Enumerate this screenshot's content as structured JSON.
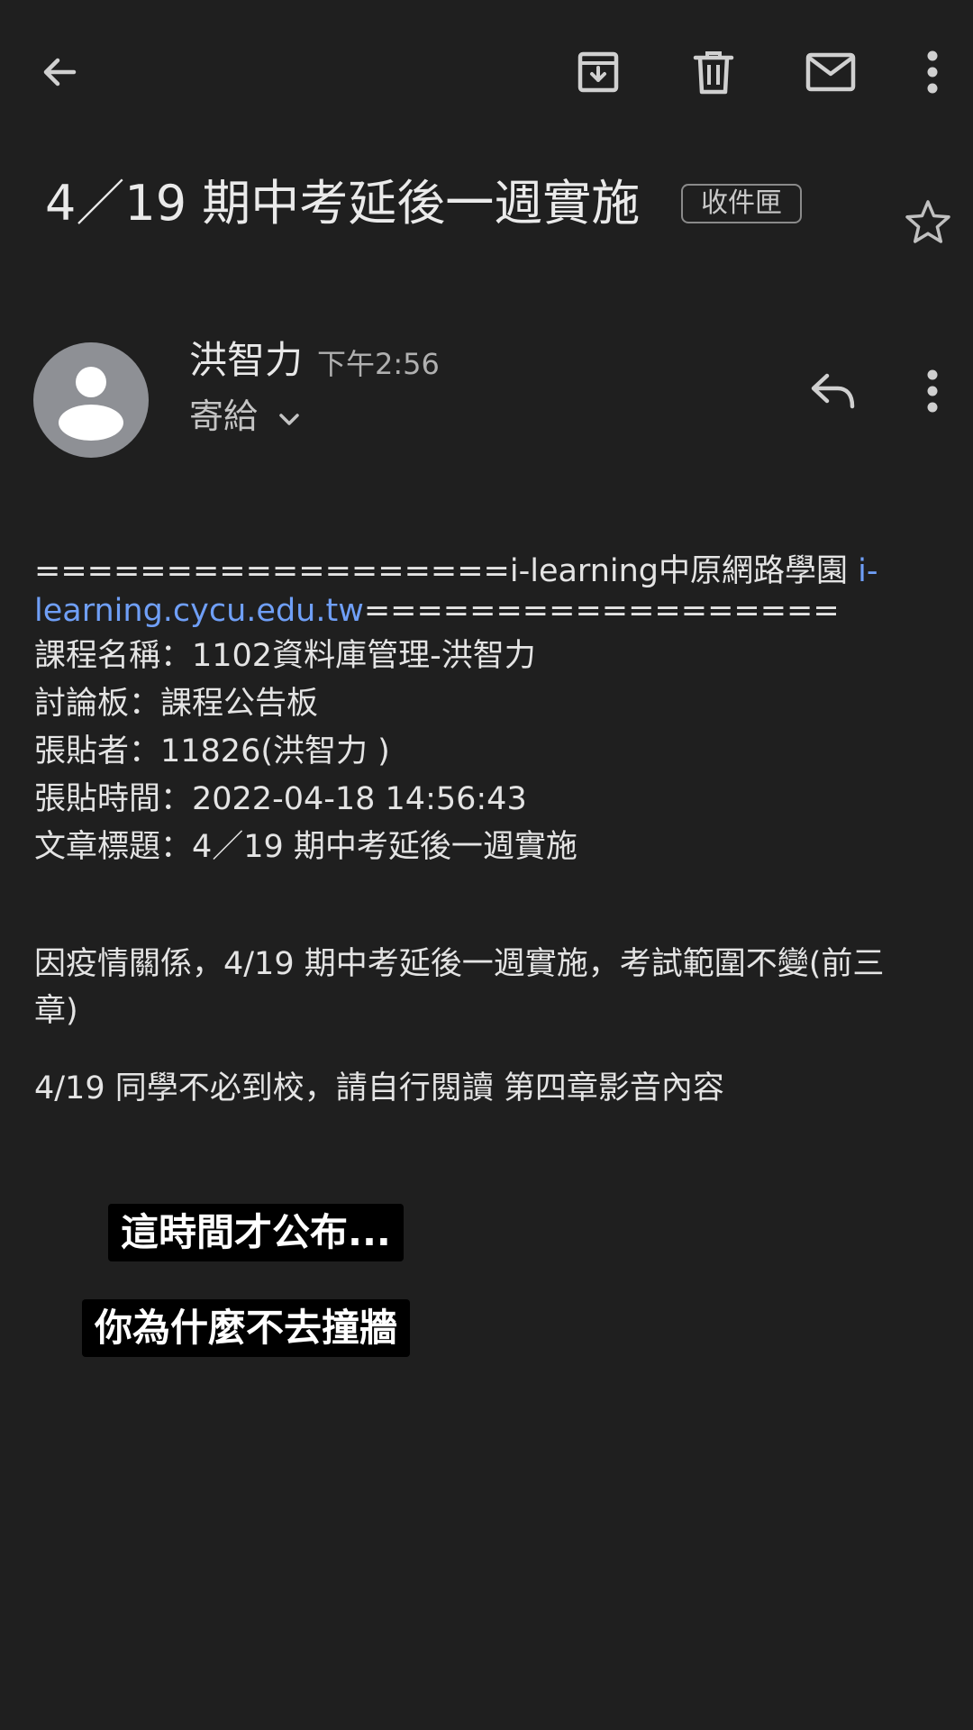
{
  "toolbar": {
    "back_icon": "arrow-back-icon",
    "archive_icon": "archive-icon",
    "delete_icon": "trash-icon",
    "mark_unread_icon": "mail-icon",
    "more_icon": "more-vert-icon"
  },
  "email": {
    "subject": "4／19 期中考延後一週實施",
    "label": "收件匣",
    "sender_name": "洪智力",
    "time": "下午2:56",
    "recipients_label": "寄給"
  },
  "body": {
    "header_prefix": "==================i-learning中原網路學園 ",
    "link_part1": "i-",
    "link_part2": "learning.cycu.edu.tw",
    "header_suffix": "==================",
    "course_line": "課程名稱：1102資料庫管理-洪智力",
    "board_line": "討論板：課程公告板",
    "poster_line": "張貼者：11826(洪智力 )",
    "posted_time_line": "張貼時間：2022-04-18 14:56:43",
    "title_line": "文章標題：4／19 期中考延後一週實施",
    "paragraph1_line1": "因疫情關係，4/19 期中考延後一週實施，考試範圍不變(前三",
    "paragraph1_line2": "章)",
    "paragraph2": "4/19 同學不必到校，請自行閱讀 第四章影音內容"
  },
  "captions": {
    "caption1": "這時間才公布...",
    "caption2": "你為什麼不去撞牆"
  },
  "colors": {
    "background": "#1f1f1f",
    "link": "#6f9ff7",
    "caption_bg": "#000000"
  }
}
